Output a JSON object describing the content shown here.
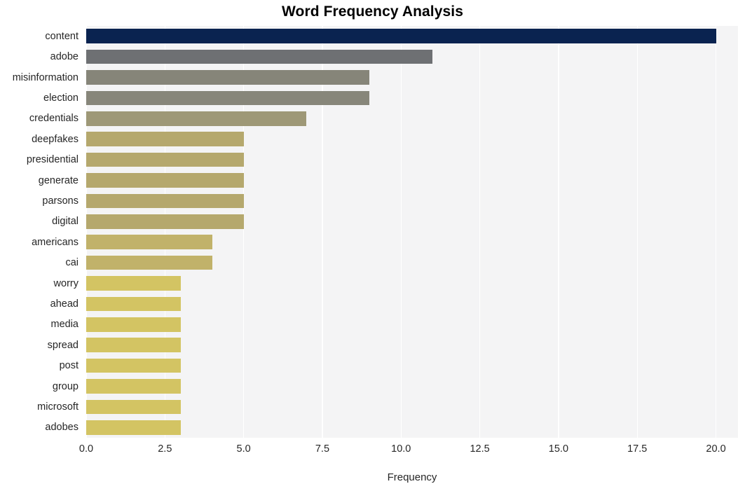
{
  "chart_data": {
    "type": "bar",
    "orientation": "horizontal",
    "title": "Word Frequency Analysis",
    "xlabel": "Frequency",
    "ylabel": "",
    "xlim": [
      0,
      20.7
    ],
    "xticks": [
      "0.0",
      "2.5",
      "5.0",
      "7.5",
      "10.0",
      "12.5",
      "15.0",
      "17.5",
      "20.0"
    ],
    "xtick_values": [
      0,
      2.5,
      5,
      7.5,
      10,
      12.5,
      15,
      17.5,
      20
    ],
    "grid": true,
    "grid_axis": "x",
    "grid_color": "#ffffff",
    "plot_background": "#f4f4f5",
    "figure_background": "#ffffff",
    "legend": null,
    "categories": [
      "content",
      "adobe",
      "misinformation",
      "election",
      "credentials",
      "deepfakes",
      "presidential",
      "generate",
      "parsons",
      "digital",
      "americans",
      "cai",
      "worry",
      "ahead",
      "media",
      "spread",
      "post",
      "group",
      "microsoft",
      "adobes"
    ],
    "values": [
      20,
      11,
      9,
      9,
      7,
      5,
      5,
      5,
      5,
      5,
      4,
      4,
      3,
      3,
      3,
      3,
      3,
      3,
      3,
      3
    ],
    "bar_colors": [
      "#0a2350",
      "#6e7073",
      "#868579",
      "#87867a",
      "#9e9877",
      "#b5a86d",
      "#b5a86d",
      "#b5a86d",
      "#b5a86d",
      "#b5a86d",
      "#c1b26a",
      "#c1b26a",
      "#d3c463",
      "#d3c463",
      "#d3c463",
      "#d3c463",
      "#d3c463",
      "#d3c463",
      "#d3c463",
      "#d3c463"
    ]
  }
}
